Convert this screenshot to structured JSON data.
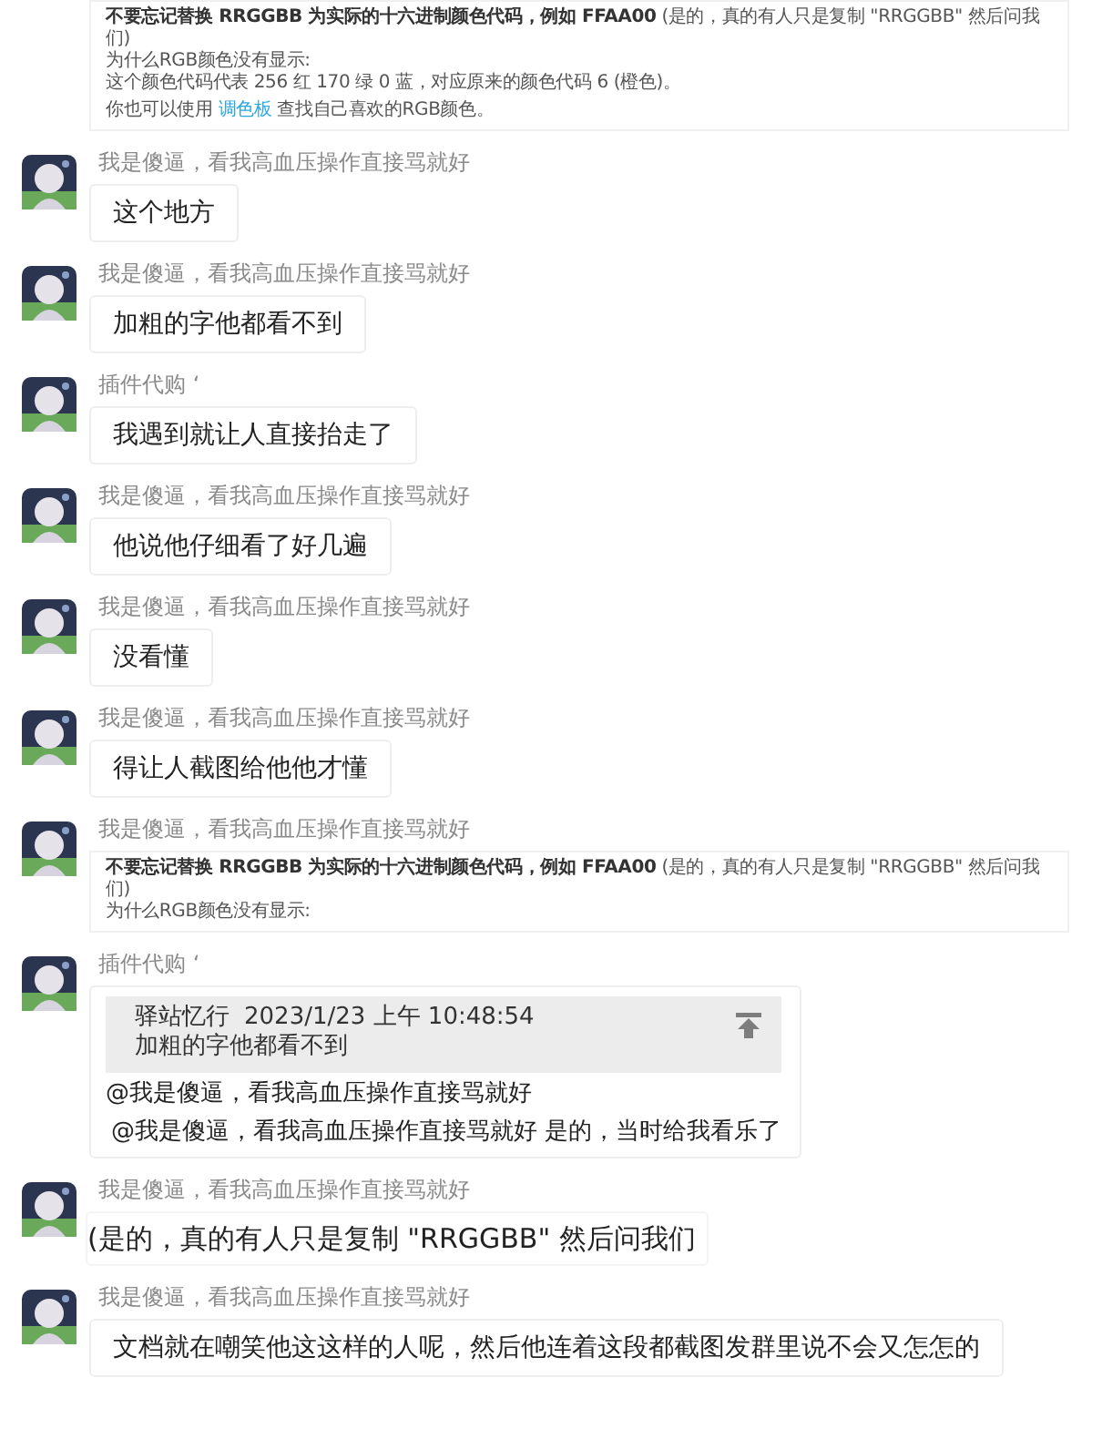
{
  "messages": [
    {
      "paragraphs": [
        {
          "lines": [
            {
              "text": "**不要忘记替换 RRGGBB 为实际的十六进制颜色代码，例如 FFAA00** (是的，真的有人只是复制 \"RRGGBB\" 然后问我们)"
            },
            {
              "text": "为什么RGB颜色没有显示:"
            },
            {
              "text": "这个颜色代码代表 256 红 170 绿 0 蓝，对应原来的颜色代码 6 (橙色)。"
            }
          ]
        },
        {
          "lines": [
            {
              "text": "你也可以使用 ",
              "link": "调色板",
              "after": " 查找自己喜欢的RGB颜色。"
            }
          ]
        }
      ]
    },
    {
      "kind": "text",
      "sender": "我是傻逼，看我高血压操作直接骂就好",
      "text": "这个地方"
    },
    {
      "kind": "text",
      "sender": "我是傻逼，看我高血压操作直接骂就好",
      "text": "加粗的字他都看不到"
    },
    {
      "kind": "text",
      "sender": "插件代购 ‘",
      "text": "我遇到就让人直接抬走了"
    },
    {
      "kind": "text",
      "sender": "我是傻逼，看我高血压操作直接骂就好",
      "text": "他说他仔细看了好几遍"
    },
    {
      "kind": "text",
      "sender": "我是傻逼，看我高血压操作直接骂就好",
      "text": "没看懂"
    },
    {
      "kind": "text",
      "sender": "我是傻逼，看我高血压操作直接骂就好",
      "text": "得让人截图给他他才懂"
    },
    {
      "sender": "我是傻逼，看我高血压操作直接骂就好",
      "paragraphs": [
        {
          "lines": [
            {
              "text": "**不要忘记替换 RRGGBB 为实际的十六进制颜色代码，例如 FFAA00** (是的，真的有人只是复制 \"RRGGBB\" 然后问我们)"
            },
            {
              "text": "为什么RGB颜色没有显示:"
            }
          ]
        }
      ]
    },
    {
      "kind": "reply",
      "sender": "插件代购 ‘",
      "quote": {
        "author": "驿站忆行",
        "time": "2023/1/23 上午 10:48:54",
        "text": "加粗的字他都看不到"
      },
      "lines": [
        "@我是傻逼，看我高血压操作直接骂就好",
        "@我是傻逼，看我高血压操作直接骂就好 是的，当时给我看乐了"
      ]
    },
    {
      "kind": "tight",
      "sender": "我是傻逼，看我高血压操作直接骂就好",
      "text": "(是的，真的有人只是复制 \"RRGGBB\" 然后问我们"
    },
    {
      "kind": "text",
      "sender": "我是傻逼，看我高血压操作直接骂就好",
      "text": "文档就在嘲笑他这这样的人呢，然后他连着这段都截图发群里说不会又怎怎的"
    }
  ]
}
